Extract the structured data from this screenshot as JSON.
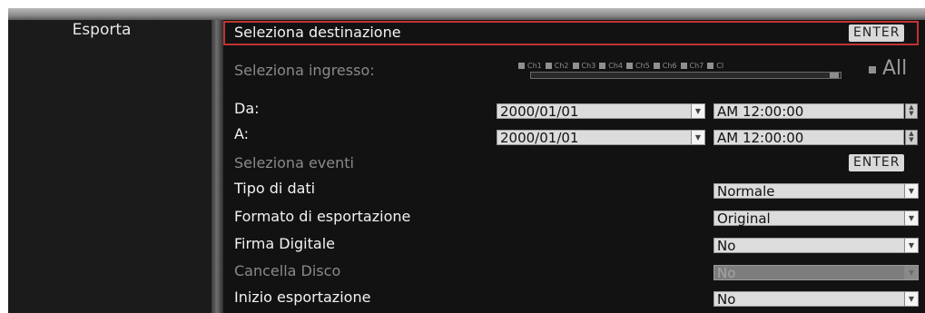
{
  "sidebar": {
    "title": "Esporta"
  },
  "rows": {
    "destination": {
      "label": "Seleziona destinazione",
      "button": "ENTER"
    },
    "input": {
      "label": "Seleziona ingresso:",
      "channels": [
        "Ch1",
        "Ch2",
        "Ch3",
        "Ch4",
        "Ch5",
        "Ch6",
        "Ch7",
        "Cl"
      ],
      "all": "All"
    },
    "from": {
      "label": "Da:",
      "date": "2000/01/01",
      "time": "AM 12:00:00"
    },
    "to": {
      "label": "A:",
      "date": "2000/01/01",
      "time": "AM 12:00:00"
    },
    "events": {
      "label": "Seleziona eventi",
      "button": "ENTER"
    },
    "data_type": {
      "label": "Tipo di dati",
      "value": "Normale"
    },
    "export_format": {
      "label": "Formato di esportazione",
      "value": "Original"
    },
    "digital_signature": {
      "label": "Firma Digitale",
      "value": "No"
    },
    "erase_disk": {
      "label": "Cancella Disco",
      "value": "No"
    },
    "start_export": {
      "label": "Inizio esportazione",
      "value": "No"
    }
  },
  "icons": {
    "dropdown": "chevron-down-icon",
    "spinner": "spinner-icon",
    "checkbox": "checkbox-icon"
  }
}
